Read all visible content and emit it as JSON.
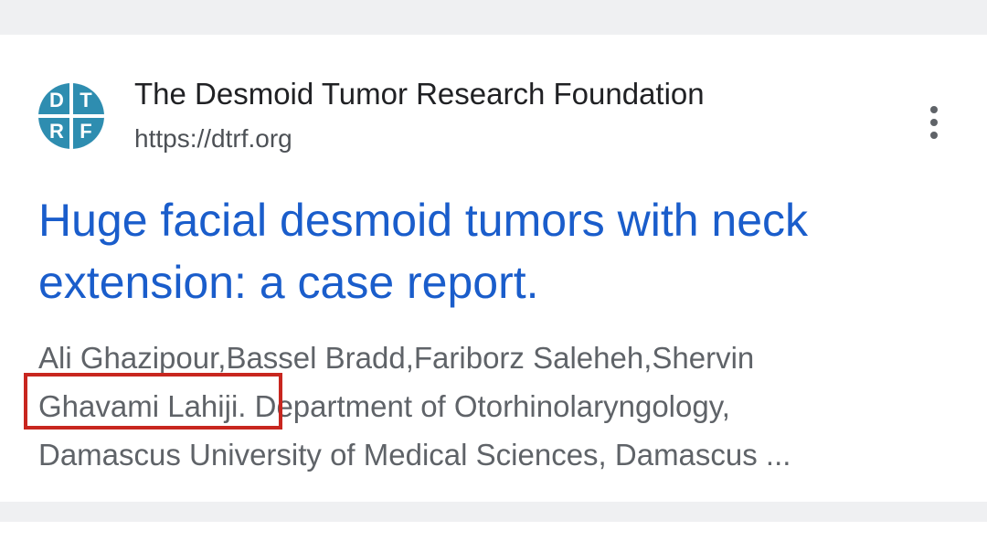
{
  "result": {
    "site_icon": {
      "name": "dtrf-logo-icon",
      "letters": [
        "D",
        "T",
        "R",
        "F"
      ],
      "color": "#2e8db0"
    },
    "site_name": "The Desmoid Tumor Research Foundation",
    "site_url": "https://dtrf.org",
    "title_line1": "Huge facial desmoid tumors with neck",
    "title_line2": "extension: a case report.",
    "snippet_line1": "Ali Ghazipour,Bassel Bradd,Fariborz Saleheh,Shervin",
    "snippet_line2": "Ghavami Lahiji. Department of Otorhinolaryngology,",
    "snippet_line3": "Damascus University of Medical Sciences, Damascus ...",
    "more_icon": "more-vert-icon"
  },
  "colors": {
    "title_link": "#1a5dcb",
    "highlight_border": "#c8261f",
    "snippet_text": "#5f6368",
    "background_bar": "#eff0f2"
  }
}
